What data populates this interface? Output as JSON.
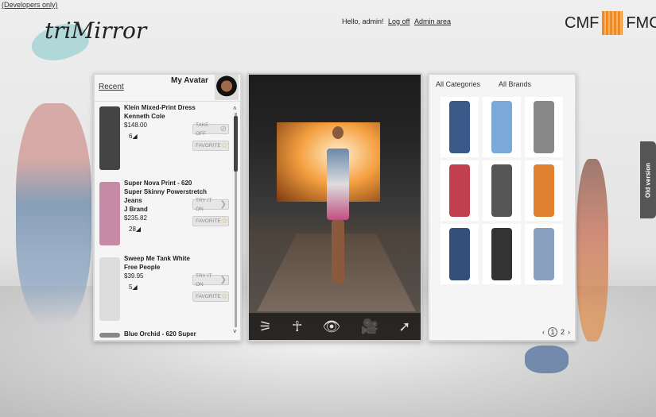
{
  "dev_label": "(Developers only)",
  "logo_text": "triMirror",
  "user": {
    "greeting": "Hello, admin!",
    "logoff": "Log off",
    "admin": "Admin area"
  },
  "brand": {
    "left": "CMF",
    "right": "FMC"
  },
  "left_panel": {
    "filter": "Recent",
    "avatar_label": "My Avatar",
    "items": [
      {
        "title": "Klein Mixed-Print Dress",
        "brand": "Kenneth Cole",
        "price": "$148.00",
        "count": "6",
        "action": "TAKE OFF",
        "favorite": "FAVORITE",
        "color": "#444"
      },
      {
        "title": "Super Nova Print - 620 Super Skinny Powerstretch Jeans",
        "brand": "J Brand",
        "price": "$235.82",
        "count": "28",
        "action": "TRY IT ON",
        "favorite": "FAVORITE",
        "color": "#c78aa6"
      },
      {
        "title": "Sweep Me Tank White",
        "brand": "Free People",
        "price": "$39.95",
        "count": "5",
        "action": "TRY IT ON",
        "favorite": "FAVORITE",
        "color": "#ddd"
      },
      {
        "title": "Blue Orchid - 620 Super",
        "brand": "",
        "price": "",
        "count": "",
        "action": "",
        "favorite": "",
        "color": "#888"
      }
    ]
  },
  "stage": {
    "tools": [
      "background-icon",
      "pose-icon",
      "eye-icon",
      "camera-icon",
      "share-icon"
    ]
  },
  "right_panel": {
    "categories": "All Categories",
    "brands": "All Brands",
    "products": [
      "#3a5a8a",
      "#7aa8d8",
      "#888",
      "#c04050",
      "#555",
      "#e08030",
      "#33507a",
      "#333",
      "#8aa0c0"
    ],
    "pages": [
      "1",
      "2"
    ]
  },
  "old_version": "Old version"
}
